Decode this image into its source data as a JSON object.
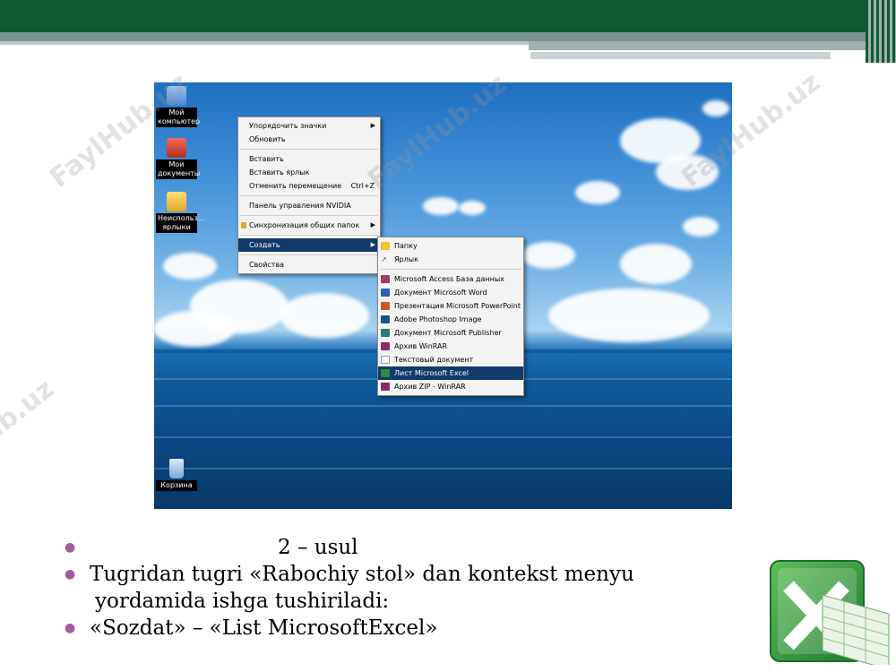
{
  "watermark_text": "FaylHub.uz",
  "desktop": {
    "icons": [
      {
        "label": "Мой компьютер",
        "icon": "computer-icon",
        "color": "#6f9ad8"
      },
      {
        "label": "Мои документы",
        "icon": "folder-documents-icon",
        "color": "#d7443d"
      },
      {
        "label": "Неиспольз... ярлыки",
        "icon": "folder-icon",
        "color": "#f0c233"
      },
      {
        "label": "Корзина",
        "icon": "recycle-bin-icon",
        "color": "#7aa7d9"
      }
    ]
  },
  "context_menu": {
    "items": [
      {
        "label": "Упорядочить значки",
        "has_submenu": true
      },
      {
        "label": "Обновить"
      },
      {
        "label": "Вставить"
      },
      {
        "label": "Вставить ярлык"
      },
      {
        "label": "Отменить перемещение",
        "shortcut": "Ctrl+Z"
      },
      {
        "label": "Панель управления NVIDIA"
      },
      {
        "label": "Синхронизация общих папок",
        "has_submenu": true
      },
      {
        "label": "Создать",
        "has_submenu": true,
        "highlighted": true
      },
      {
        "label": "Свойства"
      }
    ]
  },
  "create_submenu": {
    "items": [
      {
        "label": "Папку",
        "icon": "folder-icon",
        "color": "#f0c233"
      },
      {
        "label": "Ярлык",
        "icon": "shortcut-icon",
        "color": "#2a7a2a"
      },
      {
        "label": "Microsoft Access База данных",
        "icon": "access-icon",
        "color": "#a03a6a"
      },
      {
        "label": "Документ Microsoft Word",
        "icon": "word-icon",
        "color": "#2b5fb4"
      },
      {
        "label": "Презентация Microsoft PowerPoint",
        "icon": "powerpoint-icon",
        "color": "#d0562a"
      },
      {
        "label": "Adobe Photoshop Image",
        "icon": "photoshop-icon",
        "color": "#1f4f8f"
      },
      {
        "label": "Документ Microsoft Publisher",
        "icon": "publisher-icon",
        "color": "#2c7a6a"
      },
      {
        "label": "Архив WinRAR",
        "icon": "winrar-icon",
        "color": "#8a2a6a"
      },
      {
        "label": "Текстовый документ",
        "icon": "text-document-icon",
        "color": "#ffffff"
      },
      {
        "label": "Лист Microsoft Excel",
        "icon": "excel-icon",
        "color": "#2e8b3a",
        "highlighted": true
      },
      {
        "label": "Архив ZIP - WinRAR",
        "icon": "winrar-zip-icon",
        "color": "#8a2a6a"
      }
    ]
  },
  "slide_text": {
    "bullet1": "2 – usul",
    "bullet2_line1": "Tugridan tugri «Rabochiy stol» dan kontekst menyu",
    "bullet2_line2": "yordamida ishga tushiriladi:",
    "bullet3": "«Sozdat» – «List MicrosoftExcel»"
  },
  "colors": {
    "header_green": "#0e5a32",
    "menu_highlight": "#0f3a6b",
    "bullet_color": "#a55aa0",
    "excel_green": "#2e8b3a"
  }
}
